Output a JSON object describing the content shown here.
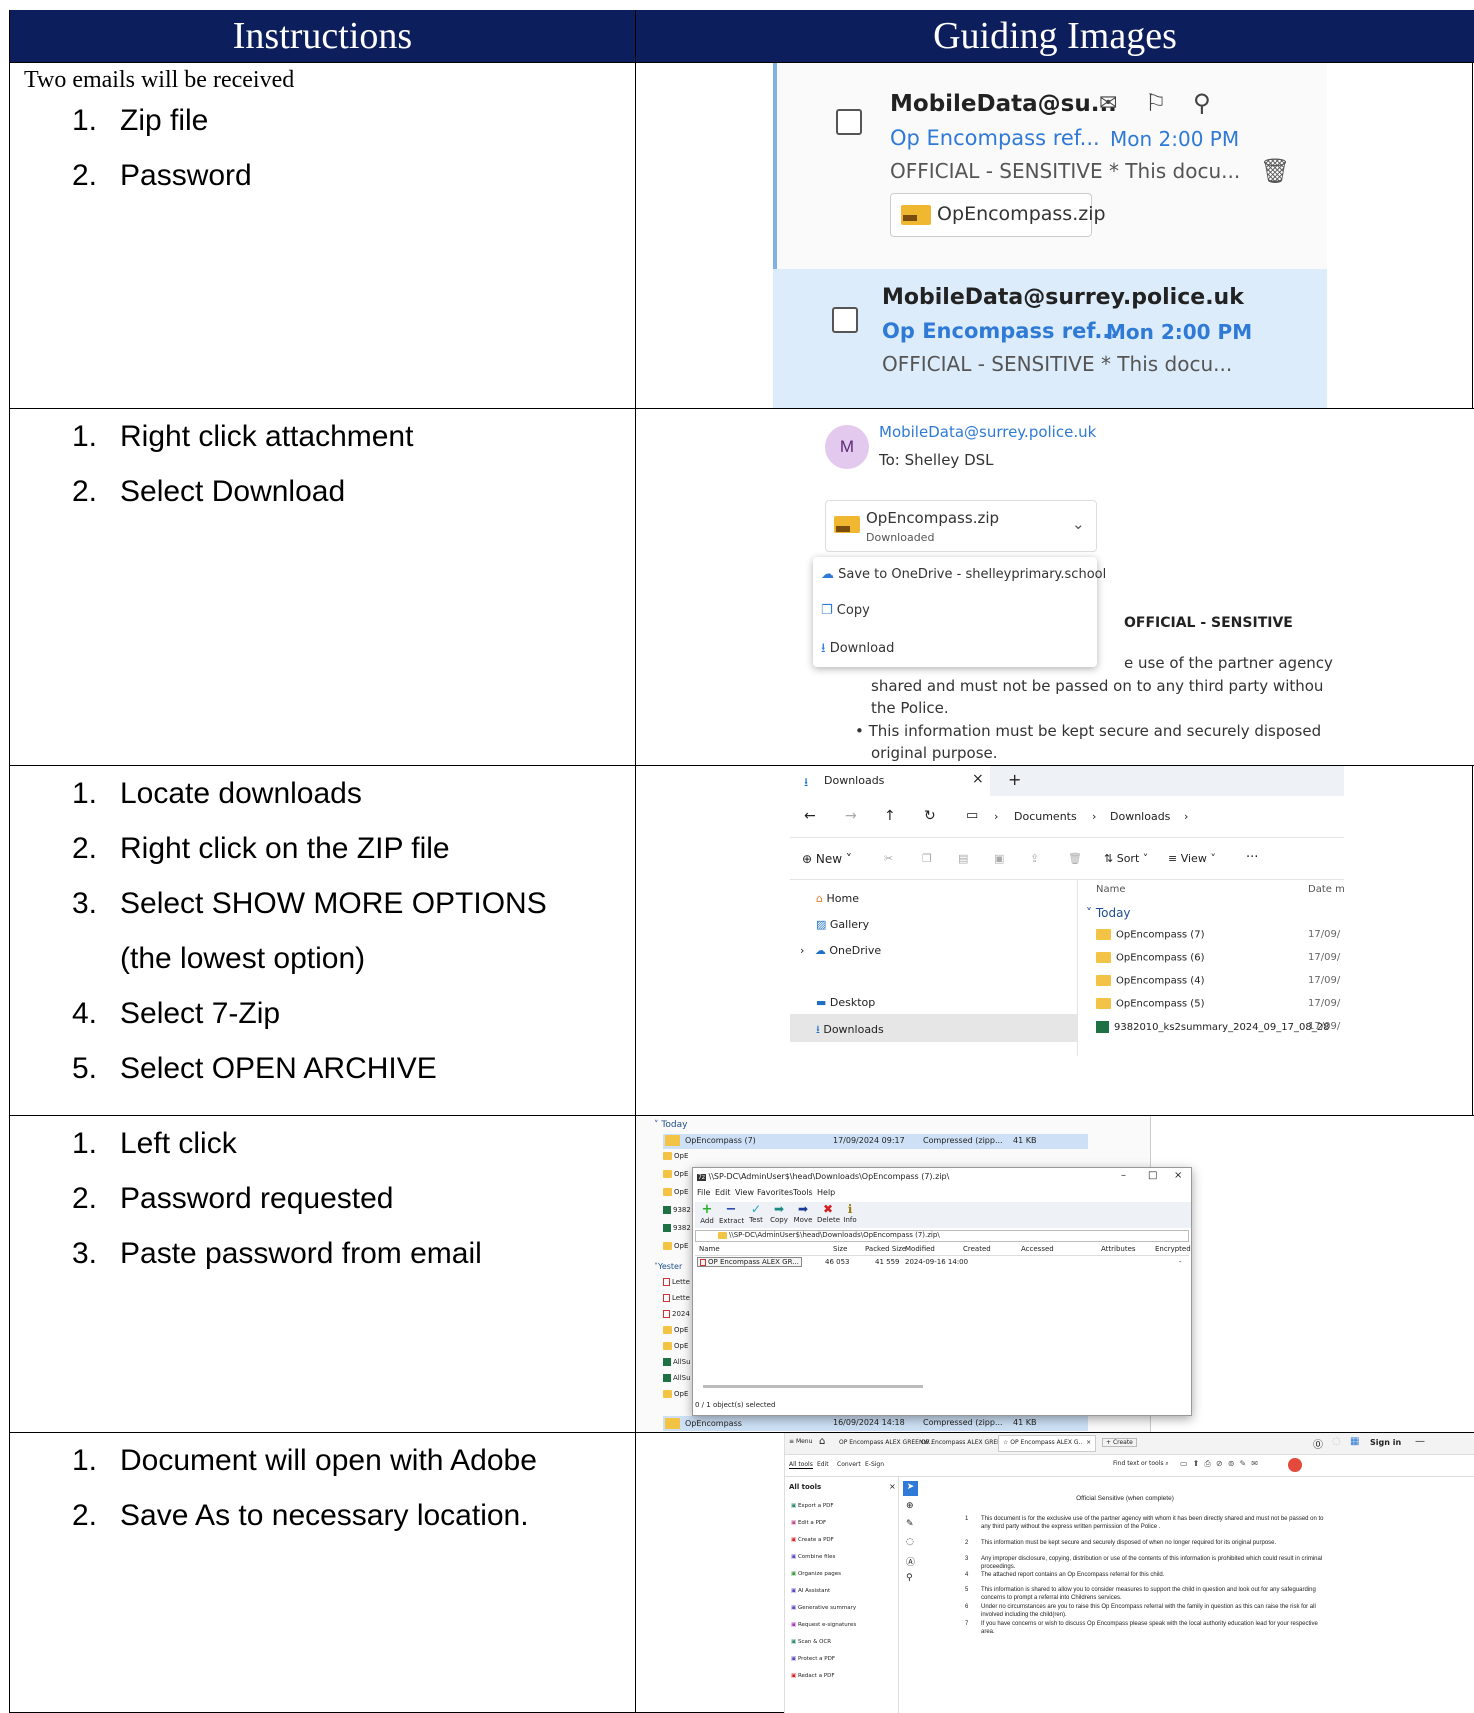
{
  "table": {
    "headers": {
      "instructions": "Instructions",
      "guiding_images": "Guiding Images"
    },
    "rows": [
      {
        "intro": "Two emails will be received",
        "steps": [
          {
            "num": "1.",
            "text": "Zip file"
          },
          {
            "num": "2.",
            "text": "Password"
          }
        ]
      },
      {
        "steps": [
          {
            "num": "1.",
            "text": "Right click attachment"
          },
          {
            "num": "2.",
            "text": "Select Download"
          }
        ]
      },
      {
        "steps": [
          {
            "num": "1.",
            "text": "Locate downloads"
          },
          {
            "num": "2.",
            "text": "Right click on the ZIP file"
          },
          {
            "num": "3.",
            "text": "Select SHOW MORE OPTIONS"
          },
          {
            "num": "",
            "text": "(the lowest option)"
          },
          {
            "num": "4.",
            "text": "Select 7-Zip"
          },
          {
            "num": "5.",
            "text": "Select OPEN ARCHIVE"
          }
        ]
      },
      {
        "steps": [
          {
            "num": "1.",
            "text": "Left click"
          },
          {
            "num": "2.",
            "text": "Password requested"
          },
          {
            "num": "3.",
            "text": "Paste password from email"
          }
        ]
      },
      {
        "steps": [
          {
            "num": "1.",
            "text": "Document will open with Adobe"
          },
          {
            "num": "2.",
            "text": "Save As to necessary location."
          }
        ]
      }
    ]
  },
  "img1": {
    "mail1": {
      "sender": "MobileData@su...",
      "subject": "Op Encompass ref...",
      "time": "Mon 2:00 PM",
      "preview": "OFFICIAL - SENSITIVE * This docu...",
      "attachment": "OpEncompass.zip"
    },
    "mail2": {
      "sender": "MobileData@surrey.police.uk",
      "subject": "Op Encompass ref...",
      "time": "Mon 2:00 PM",
      "preview": "OFFICIAL - SENSITIVE * This docu..."
    }
  },
  "img2": {
    "avatar": "M",
    "sender": "MobileData@surrey.police.uk",
    "to": "To: Shelley DSL",
    "file": "OpEncompass.zip",
    "status": "Downloaded",
    "menu": [
      "Save to OneDrive - shelleyprimary.school",
      "Copy",
      "Download"
    ],
    "heading": "OFFICIAL - SENSITIVE",
    "body": [
      "e use of the partner agency",
      "shared and must not be passed on to any third party withou",
      "the Police.",
      "This information must be kept secure and securely disposed",
      "original purpose."
    ]
  },
  "img3": {
    "tab": "Downloads",
    "breadcrumb": [
      "Documents",
      "Downloads"
    ],
    "toolbar": {
      "new": "New",
      "sort": "Sort",
      "view": "View",
      "more": "···"
    },
    "nav": [
      "Home",
      "Gallery",
      "OneDrive",
      "Desktop",
      "Downloads"
    ],
    "col_name": "Name",
    "col_date": "Date m",
    "group": "Today",
    "files": [
      {
        "name": "OpEncompass (7)",
        "date": "17/09/"
      },
      {
        "name": "OpEncompass (6)",
        "date": "17/09/"
      },
      {
        "name": "OpEncompass (4)",
        "date": "17/09/"
      },
      {
        "name": "OpEncompass (5)",
        "date": "17/09/"
      },
      {
        "name": "9382010_ks2summary_2024_09_17_08_28",
        "date": "17/09/"
      }
    ]
  },
  "img4": {
    "group_today": "Today",
    "top_row": {
      "name": "OpEncompass (7)",
      "date": "17/09/2024 09:17",
      "type": "Compressed (zipp...",
      "size": "41 KB"
    },
    "bottom_row": {
      "name": "OpEncompass",
      "date": "16/09/2024 14:18",
      "type": "Compressed (zipp...",
      "size": "41 KB"
    },
    "group_yesterday": "Yester",
    "left_items": [
      "OpE",
      "OpE",
      "OpE",
      "9382",
      "9382",
      "OpE",
      "Lette",
      "Lette",
      "2024",
      "OpE",
      "OpE",
      "AllSu",
      "AllSu",
      "OpE"
    ],
    "title": "\\\\SP-DC\\AdminUser$\\head\\Downloads\\OpEncompass (7).zip\\",
    "menu": [
      "File",
      "Edit",
      "View",
      "Favorites",
      "Tools",
      "Help"
    ],
    "tools": [
      "Add",
      "Extract",
      "Test",
      "Copy",
      "Move",
      "Delete",
      "Info"
    ],
    "path": "\\\\SP-DC\\AdminUser$\\head\\Downloads\\OpEncompass (7).zip\\",
    "cols": [
      "Name",
      "Size",
      "Packed Size",
      "Modified",
      "Created",
      "Accessed",
      "Attributes",
      "Encrypted"
    ],
    "row": {
      "name": "OP Encompass ALEX GR...",
      "size": "46 053",
      "packed": "41 559",
      "modified": "2024-09-16 14:00",
      "encrypted": "-"
    },
    "status": "0 / 1 object(s) selected"
  },
  "img5": {
    "tabs": [
      "Menu",
      "OP Encompass ALEX GREENW..",
      "OP Encompass ALEX GREENW..",
      "OP Encompass ALEX G..",
      "Create"
    ],
    "sign_in": "Sign in",
    "sub_tabs": [
      "All tools",
      "Edit",
      "Convert",
      "E-Sign"
    ],
    "find": "Find text or tools",
    "panel_title": "All tools",
    "tools": [
      "Export a PDF",
      "Edit a PDF",
      "Create a PDF",
      "Combine files",
      "Organize pages",
      "AI Assistant",
      "Generative summary",
      "Request e-signatures",
      "Scan & OCR",
      "Protect a PDF",
      "Redact a PDF"
    ],
    "doc_title": "Official Sensitive (when complete)",
    "items": [
      {
        "n": "1",
        "t": "This document is for the exclusive use of the partner agency with whom it has been directly shared and must not be passed on to any third party without the express written permission of the Police ."
      },
      {
        "n": "2",
        "t": "This information must be kept secure and securely disposed of when no longer required for its original purpose."
      },
      {
        "n": "3",
        "t": "Any improper disclosure, copying, distribution or use of the contents of this information is prohibited which could result in criminal proceedings."
      },
      {
        "n": "4",
        "t": "The attached report contains an Op Encompass referral for this child."
      },
      {
        "n": "5",
        "t": "This information is shared to allow you to consider measures to support the child in question and look out for any safeguarding concerns to prompt a referral into Childrens services."
      },
      {
        "n": "6",
        "t": "Under no circumstances are you to raise this Op Encompass referral with the family in question as this can raise the risk for all involved including the child(ren)."
      },
      {
        "n": "7",
        "t": "If you have concerns or wish to discuss Op Encompass please speak with the local authority education lead for your respective area."
      }
    ]
  },
  "colors": {
    "header_bg": "#0d1e5c",
    "link_blue": "#1a73e8",
    "selected_mail": "#dcecfb"
  }
}
